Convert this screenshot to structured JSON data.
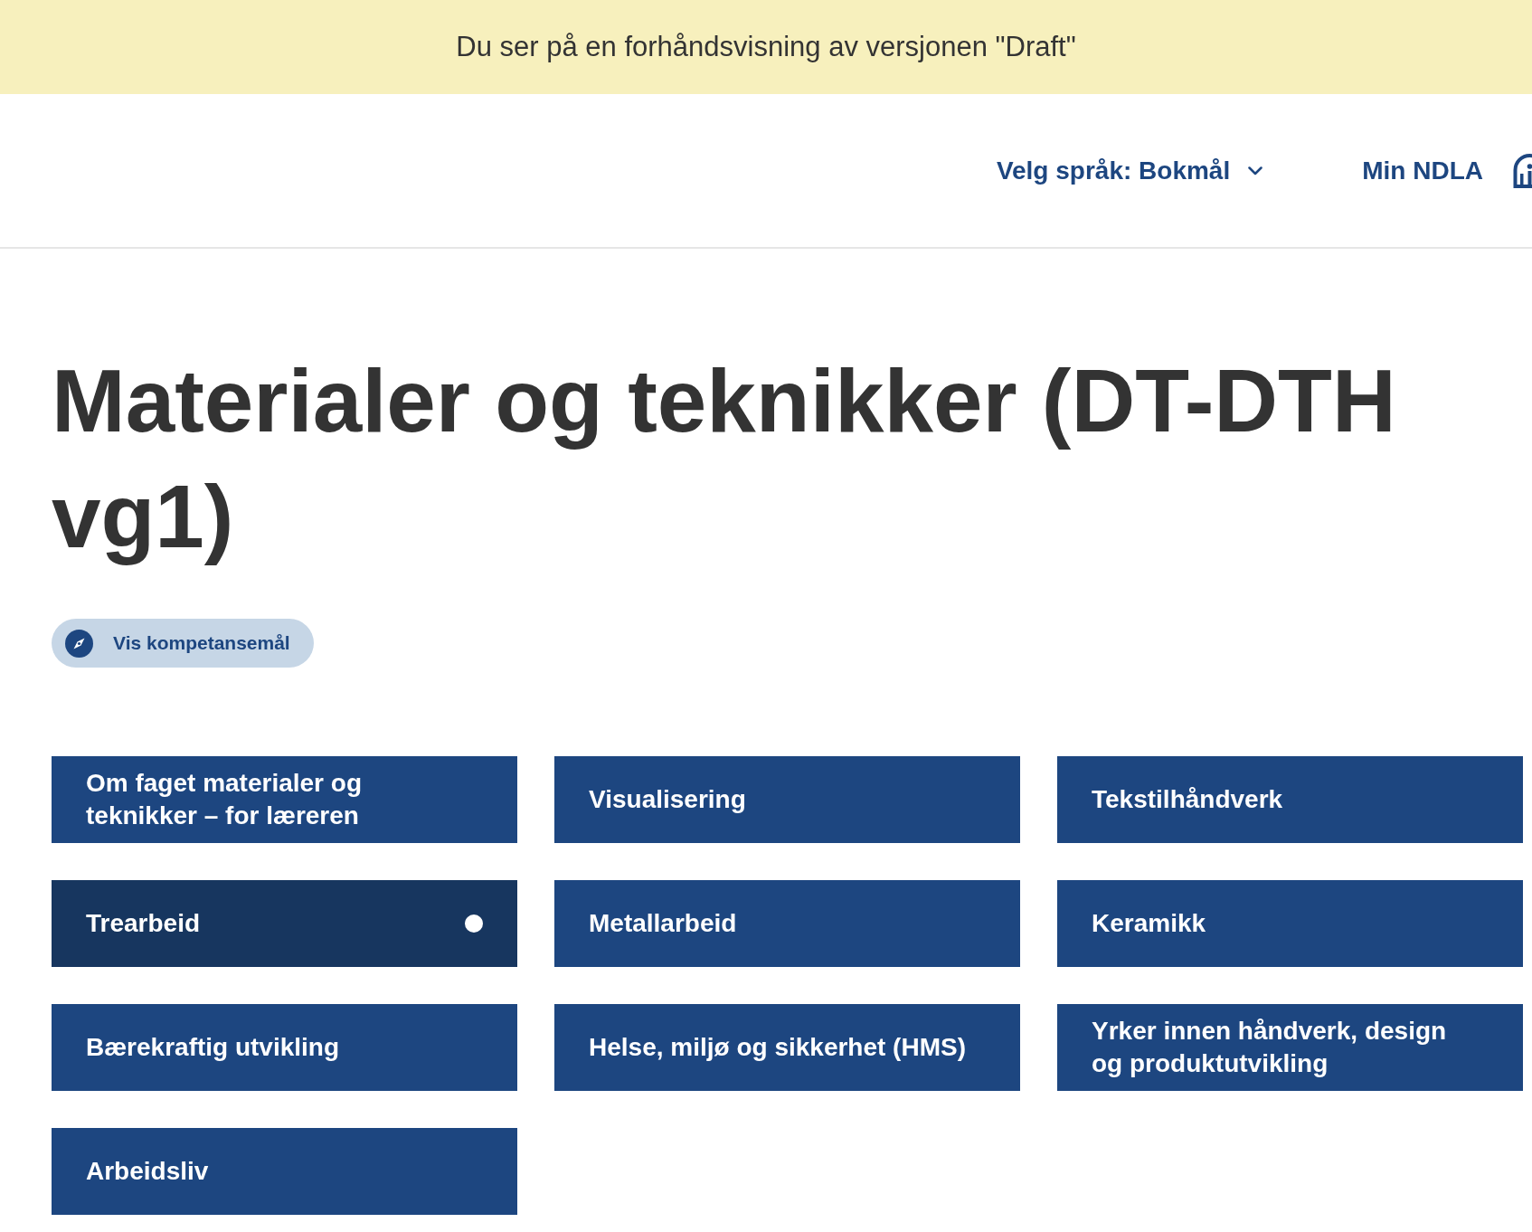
{
  "preview_banner": {
    "text": "Du ser på en forhåndsvisning av versjonen \"Draft\""
  },
  "header": {
    "language_selector": {
      "label": "Velg språk: Bokmål",
      "expanded": false
    },
    "my_page_link": {
      "label": "Min NDLA"
    }
  },
  "page": {
    "title": "Materialer og teknikker (DT-DTH vg1)",
    "competence_button": {
      "label": "Vis kompetansemål"
    }
  },
  "topics": [
    {
      "label": "Om faget materialer og teknikker – for læreren",
      "selected": false
    },
    {
      "label": "Visualisering",
      "selected": false
    },
    {
      "label": "Tekstilhåndverk",
      "selected": false
    },
    {
      "label": "Trearbeid",
      "selected": true
    },
    {
      "label": "Metallarbeid",
      "selected": false
    },
    {
      "label": "Keramikk",
      "selected": false
    },
    {
      "label": "Bærekraftig utvikling",
      "selected": false
    },
    {
      "label": "Helse, miljø og sikkerhet (HMS)",
      "selected": false
    },
    {
      "label": "Yrker innen håndverk, design og produktutvikling",
      "selected": false
    },
    {
      "label": "Arbeidsliv",
      "selected": false
    }
  ]
}
